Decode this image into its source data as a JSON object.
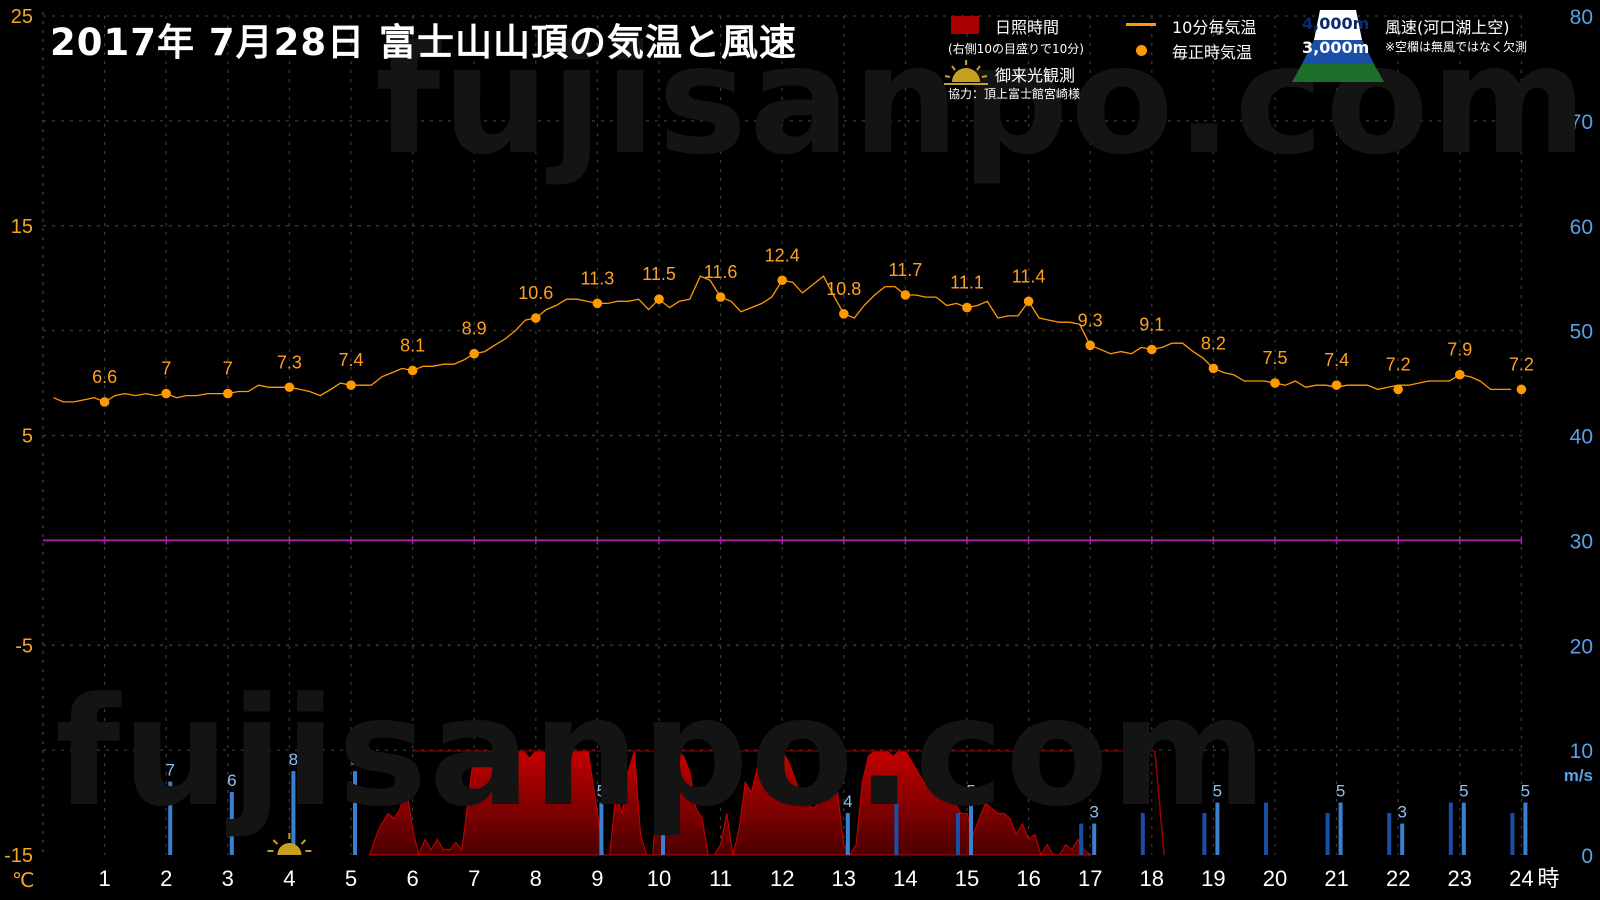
{
  "header": {
    "title": "2017年  7月28日   富士山山頂の気温と風速",
    "watermark": "fujisanpo.com"
  },
  "legend": {
    "sunshine_label": "日照時間",
    "sunshine_note": "(右側10の目盛りで10分)",
    "temp10_label": "10分毎気温",
    "hourly_label": "毎正時気温",
    "sunrise_label": "御来光観測",
    "credit": "協力：頂上富士館宮崎様",
    "alt4000_label": "4,000m",
    "alt3000_label": "3,000m",
    "wind_label": "風速(河口湖上空)",
    "wind_note": "※空欄は無風ではなく欠測"
  },
  "colors": {
    "temp_axis": "#f5a623",
    "wind_axis": "#5aa0e6",
    "temp_line": "#ff9900",
    "sunshine": "#a80000",
    "zero_line": "#a020a0",
    "wind_4000": "#3a7fd0",
    "wind_3000": "#1a4fa8"
  },
  "chart_data": {
    "type": "line",
    "x_unit_label": "時",
    "y_left_unit": "℃",
    "y_right_unit": "m/s",
    "x_ticks": [
      1,
      2,
      3,
      4,
      5,
      6,
      7,
      8,
      9,
      10,
      11,
      12,
      13,
      14,
      15,
      16,
      17,
      18,
      19,
      20,
      21,
      22,
      23,
      24
    ],
    "y_left_ticks": [
      -15,
      -5,
      5,
      15,
      25
    ],
    "y_right_ticks": [
      0,
      10,
      20,
      30,
      40,
      50,
      60,
      70,
      80
    ],
    "y_left_range": [
      -15,
      25
    ],
    "y_right_range": [
      0,
      80
    ],
    "x_range": [
      0.05,
      24
    ],
    "series_hourly_temp": {
      "x": [
        1,
        2,
        3,
        4,
        5,
        6,
        7,
        8,
        9,
        10,
        11,
        12,
        13,
        14,
        15,
        16,
        17,
        18,
        19,
        20,
        21,
        22,
        23,
        24
      ],
      "values": [
        6.6,
        7,
        7,
        7.3,
        7.4,
        8.1,
        8.9,
        10.6,
        11.3,
        11.5,
        11.6,
        12.4,
        10.8,
        11.7,
        11.1,
        11.4,
        9.3,
        9.1,
        8.2,
        7.5,
        7.4,
        7.2,
        7.9,
        7.2
      ]
    },
    "series_temp_10min": {
      "x": [
        0.17,
        0.33,
        0.5,
        0.67,
        0.83,
        1,
        1.17,
        1.33,
        1.5,
        1.67,
        1.83,
        2,
        2.17,
        2.33,
        2.5,
        2.67,
        2.83,
        3,
        3.17,
        3.33,
        3.5,
        3.67,
        3.83,
        4,
        4.17,
        4.33,
        4.5,
        4.67,
        4.83,
        5,
        5.17,
        5.33,
        5.5,
        5.67,
        5.83,
        6,
        6.17,
        6.33,
        6.5,
        6.67,
        6.83,
        7,
        7.17,
        7.33,
        7.5,
        7.67,
        7.83,
        8,
        8.17,
        8.33,
        8.5,
        8.67,
        8.83,
        9,
        9.17,
        9.33,
        9.5,
        9.67,
        9.83,
        10,
        10.17,
        10.33,
        10.5,
        10.67,
        10.83,
        11,
        11.17,
        11.33,
        11.5,
        11.67,
        11.83,
        12,
        12.17,
        12.33,
        12.5,
        12.67,
        12.83,
        13,
        13.17,
        13.33,
        13.5,
        13.67,
        13.83,
        14,
        14.17,
        14.33,
        14.5,
        14.67,
        14.83,
        15,
        15.17,
        15.33,
        15.5,
        15.67,
        15.83,
        16,
        16.17,
        16.33,
        16.5,
        16.67,
        16.83,
        17,
        17.17,
        17.33,
        17.5,
        17.67,
        17.83,
        18,
        18.17,
        18.33,
        18.5,
        18.67,
        18.83,
        19,
        19.17,
        19.33,
        19.5,
        19.67,
        19.83,
        20,
        20.17,
        20.33,
        20.5,
        20.67,
        20.83,
        21,
        21.17,
        21.33,
        21.5,
        21.67,
        21.83,
        22,
        22.17,
        22.33,
        22.5,
        22.67,
        22.83,
        23,
        23.17,
        23.33,
        23.5,
        23.67,
        23.83,
        24
      ],
      "values": [
        6.8,
        6.6,
        6.6,
        6.7,
        6.8,
        6.6,
        6.9,
        7.0,
        6.9,
        7.0,
        6.9,
        7.0,
        6.8,
        6.9,
        6.9,
        7.0,
        7.0,
        7.0,
        7.1,
        7.1,
        7.4,
        7.3,
        7.3,
        7.3,
        7.2,
        7.1,
        6.9,
        7.2,
        7.5,
        7.4,
        7.4,
        7.4,
        7.8,
        8.0,
        8.2,
        8.1,
        8.3,
        8.3,
        8.4,
        8.4,
        8.6,
        8.9,
        9.0,
        9.3,
        9.6,
        10.0,
        10.5,
        10.6,
        11.0,
        11.2,
        11.5,
        11.5,
        11.4,
        11.3,
        11.3,
        11.4,
        11.4,
        11.5,
        11.0,
        11.5,
        11.1,
        11.4,
        11.5,
        12.6,
        12.4,
        11.6,
        11.4,
        10.9,
        11.1,
        11.3,
        11.6,
        12.4,
        12.3,
        11.8,
        12.2,
        12.6,
        11.7,
        10.8,
        10.6,
        11.2,
        11.7,
        12.1,
        12.1,
        11.7,
        11.7,
        11.6,
        11.6,
        11.2,
        11.3,
        11.1,
        11.2,
        11.4,
        10.6,
        10.7,
        10.7,
        11.4,
        10.6,
        10.5,
        10.4,
        10.4,
        10.3,
        9.3,
        9.1,
        8.9,
        9.0,
        8.9,
        9.2,
        9.1,
        9.2,
        9.4,
        9.4,
        9.0,
        8.7,
        8.2,
        8.0,
        7.9,
        7.6,
        7.6,
        7.6,
        7.5,
        7.4,
        7.6,
        7.3,
        7.4,
        7.4,
        7.3,
        7.4,
        7.4,
        7.4,
        7.2,
        7.3,
        7.4,
        7.4,
        7.5,
        7.6,
        7.6,
        7.6,
        7.9,
        7.8,
        7.6,
        7.2,
        7.2,
        7.2
      ]
    },
    "series_sunshine": {
      "x": [
        5.3,
        5.45,
        5.6,
        5.7,
        5.8,
        5.9,
        6,
        6.1,
        6.2,
        6.3,
        6.4,
        6.5,
        6.6,
        6.7,
        6.8,
        7,
        7.2,
        7.4,
        7.5,
        7.7,
        7.8,
        7.9,
        8,
        8.1,
        8.2,
        8.3,
        8.5,
        8.7,
        8.85,
        9,
        9.1,
        9.2,
        9.3,
        9.4,
        9.5,
        9.6,
        9.7,
        9.8,
        9.9,
        10,
        10.1,
        10.2,
        10.3,
        10.4,
        10.5,
        10.6,
        10.7,
        10.8,
        10.9,
        11,
        11.1,
        11.2,
        11.3,
        11.4,
        11.5,
        11.6,
        11.7,
        11.8,
        11.9,
        12,
        12.1,
        12.2,
        12.3,
        12.4,
        12.5,
        12.6,
        12.7,
        12.8,
        12.9,
        13,
        13.1,
        13.2,
        13.3,
        13.4,
        13.5,
        13.6,
        13.7,
        13.8,
        13.9,
        14,
        14.1,
        14.2,
        14.3,
        14.4,
        14.5,
        14.6,
        14.7,
        14.8,
        14.9,
        15,
        15.1,
        15.2,
        15.3,
        15.4,
        15.5,
        15.6,
        15.7,
        15.8,
        15.9,
        16,
        16.1,
        16.2,
        16.3,
        16.4,
        16.5,
        16.6,
        16.7,
        16.8,
        16.9,
        17
      ],
      "values": [
        0,
        2.5,
        4,
        3.5,
        4.5,
        6.5,
        2.5,
        0,
        1.5,
        0.5,
        1.5,
        0.5,
        0.5,
        1.2,
        0.5,
        10,
        10,
        10,
        9.3,
        10,
        10,
        9.3,
        10,
        10,
        9.5,
        10,
        10,
        10,
        10,
        4,
        0,
        0,
        6,
        4,
        8,
        10,
        2,
        0,
        0,
        8,
        7,
        9.5,
        10,
        9.5,
        8,
        4.5,
        3.5,
        0,
        0,
        1,
        4,
        0,
        2.5,
        7,
        6,
        8.5,
        9,
        8.5,
        7.5,
        10,
        9,
        7.5,
        5.5,
        5,
        4.5,
        5,
        8,
        9.8,
        6,
        1,
        0,
        1,
        7,
        9.5,
        10,
        10,
        10,
        9.5,
        10,
        10,
        9,
        8,
        7,
        8,
        6.5,
        5.5,
        5,
        5,
        4,
        4,
        2,
        3.5,
        5,
        4.5,
        4,
        4,
        3.5,
        2,
        3,
        1.5,
        2,
        0,
        1,
        0,
        0,
        1,
        0.5,
        1.5,
        0.5,
        0
      ],
      "range": [
        0,
        10
      ],
      "unit_note": "右側10の目盛りで10分"
    },
    "series_wind_4000m": {
      "hours": [
        2,
        3,
        4,
        5,
        9,
        10,
        13,
        15,
        17,
        19,
        21,
        22,
        23,
        24
      ],
      "values": [
        7,
        6,
        8,
        8,
        5,
        4,
        4,
        5,
        3,
        5,
        5,
        3,
        5,
        5
      ],
      "labels": [
        7,
        6,
        8,
        8,
        5,
        4,
        4,
        5,
        3,
        5,
        5,
        3,
        5,
        5
      ]
    },
    "series_wind_3000m": {
      "hours": [
        14,
        15,
        17,
        18,
        19,
        20,
        21,
        22,
        23,
        24
      ],
      "values": [
        5,
        4,
        3,
        4,
        4,
        5,
        4,
        4,
        5,
        4
      ]
    },
    "sunrise_observation_hour": 4,
    "zero_line_value": 0
  }
}
